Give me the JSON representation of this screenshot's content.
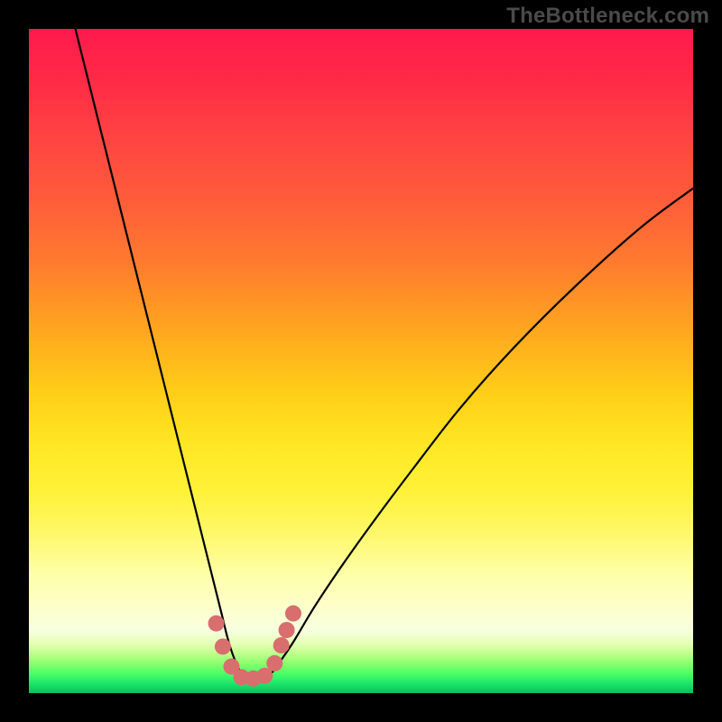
{
  "watermark": "TheBottleneck.com",
  "chart_data": {
    "type": "line",
    "title": "",
    "xlabel": "",
    "ylabel": "",
    "xlim": [
      0,
      100
    ],
    "ylim": [
      0,
      100
    ],
    "grid": false,
    "legend": false,
    "series": [
      {
        "name": "bottleneck-curve",
        "x": [
          7,
          10,
          13,
          16,
          19,
          22,
          24.5,
          26,
          27.5,
          29,
          30,
          31,
          32,
          33.5,
          35,
          36.5,
          38,
          40,
          43,
          47,
          52,
          58,
          65,
          73,
          82,
          92,
          100
        ],
        "values": [
          100,
          88,
          76,
          64,
          52,
          40,
          30,
          24,
          18,
          12,
          8,
          5,
          3,
          2,
          2,
          3,
          5,
          8,
          13,
          19,
          26,
          34,
          43,
          52,
          61,
          70,
          76
        ]
      }
    ],
    "annotations": [
      {
        "name": "trough-markers",
        "type": "points",
        "x": [
          28.2,
          29.2,
          30.5,
          32.0,
          33.8,
          35.5,
          37.0,
          38.0,
          38.8,
          39.8
        ],
        "values": [
          10.5,
          7.0,
          4.0,
          2.4,
          2.2,
          2.6,
          4.5,
          7.2,
          9.5,
          12.0
        ],
        "color": "#d86e6e",
        "size": 9
      }
    ],
    "background_scale": {
      "type": "vertical-gradient",
      "stops": [
        "#ff1a4d",
        "#ffcf17",
        "#feffa8",
        "#0bbf5d"
      ]
    }
  }
}
